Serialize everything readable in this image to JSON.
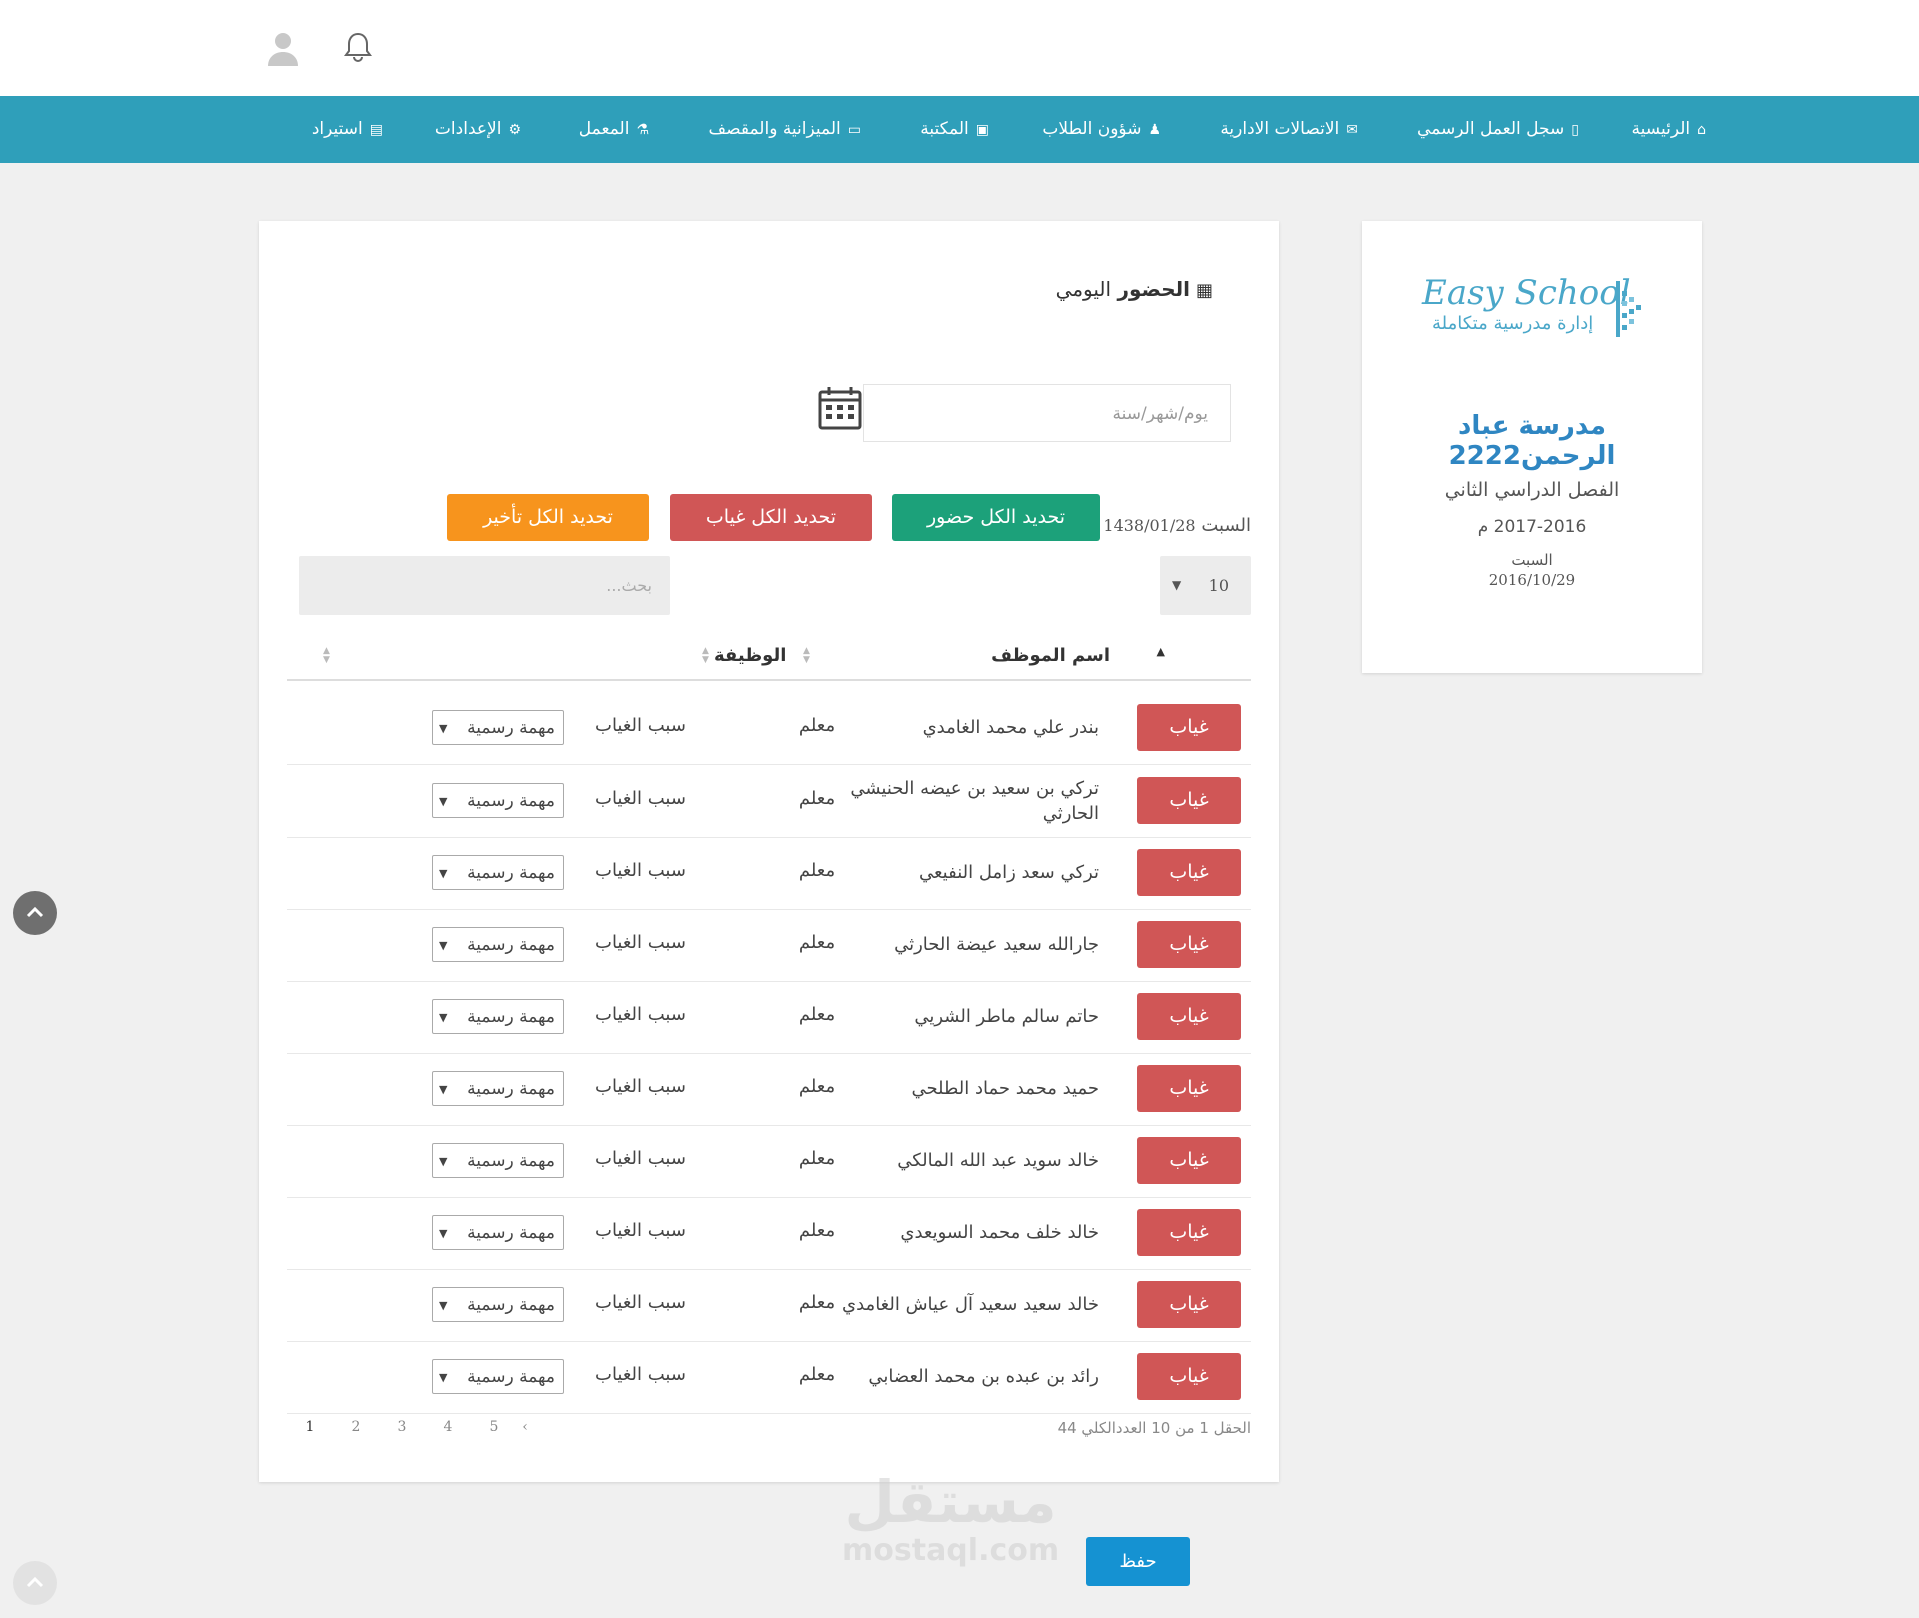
{
  "header": {
    "bell_icon": "bell-icon",
    "user_icon": "user-avatar-icon"
  },
  "nav": [
    {
      "label": "الرئيسية",
      "icon": "home-icon"
    },
    {
      "label": "سجل العمل الرسمي",
      "icon": "mobile-icon"
    },
    {
      "label": "الاتصالات الادارية",
      "icon": "envelope-icon"
    },
    {
      "label": "شؤون الطلاب",
      "icon": "person-icon"
    },
    {
      "label": "المكتبة",
      "icon": "book-icon"
    },
    {
      "label": "الميزانية والمقصف",
      "icon": "money-icon"
    },
    {
      "label": "المعمل",
      "icon": "flask-icon"
    },
    {
      "label": "الإعدادات",
      "icon": "gear-icon"
    },
    {
      "label": "استيراد",
      "icon": "excel-file-icon"
    }
  ],
  "school": {
    "logo_en": "Easy School",
    "logo_ar": "إدارة مدرسية متكاملة",
    "name": "مدرسة عباد الرحمن2222",
    "semester": "الفصل الدراسي الثاني",
    "years": "2017-2016 م",
    "day": "السبت",
    "date": "2016/10/29"
  },
  "attendance": {
    "title_bold": "الحضور",
    "title_rest": "اليومي",
    "date_placeholder": "يوم/شهر/سنة",
    "day_label": "السبت",
    "hijri_date": "1438/01/28",
    "btn_all_present": "تحديد الكل حضور",
    "btn_all_absent": "تحديد الكل غياب",
    "btn_all_late": "تحديد الكل تأخير",
    "page_size": "10",
    "search_placeholder": "بحث...",
    "col_name": "اسم الموظف",
    "col_job": "الوظيفة",
    "reason_label": "سبب الغياب",
    "absent_label": "غياب",
    "rows": [
      {
        "name": "بندر علي محمد الغامدي",
        "job": "معلم",
        "reason": "مهمة رسمية"
      },
      {
        "name": "تركي بن سعيد بن عيضه الحنيشي الحارثي",
        "job": "معلم",
        "reason": "مهمة رسمية"
      },
      {
        "name": "تركي سعد زامل النفيعي",
        "job": "معلم",
        "reason": "مهمة رسمية"
      },
      {
        "name": "جارالله سعيد عيضة الحارثي",
        "job": "معلم",
        "reason": "مهمة رسمية"
      },
      {
        "name": "حاتم سالم ماطر الشريي",
        "job": "معلم",
        "reason": "مهمة رسمية"
      },
      {
        "name": "حميد محمد حماد الطلحي",
        "job": "معلم",
        "reason": "مهمة رسمية"
      },
      {
        "name": "خالد سويد عبد الله المالكي",
        "job": "معلم",
        "reason": "مهمة رسمية"
      },
      {
        "name": "خالد خلف محمد السويعدي",
        "job": "معلم",
        "reason": "مهمة رسمية"
      },
      {
        "name": "خالد سعيد سعيد آل عياش الغامدي",
        "job": "معلم",
        "reason": "مهمة رسمية"
      },
      {
        "name": "رائد بن عبده بن محمد العضابي",
        "job": "معلم",
        "reason": "مهمة رسمية"
      }
    ],
    "info": "الحقل 1 من 10 العددالكلي 44",
    "pages": [
      "1",
      "2",
      "3",
      "4",
      "5"
    ],
    "next_arrow": "›"
  },
  "save_label": "حفظ",
  "watermark": {
    "ar": "مستقل",
    "en": "mostaql.com"
  },
  "colors": {
    "nav": "#2f9fba",
    "present": "#1ca17a",
    "absent": "#d05656",
    "late": "#f7941d",
    "save": "#1592d2"
  }
}
